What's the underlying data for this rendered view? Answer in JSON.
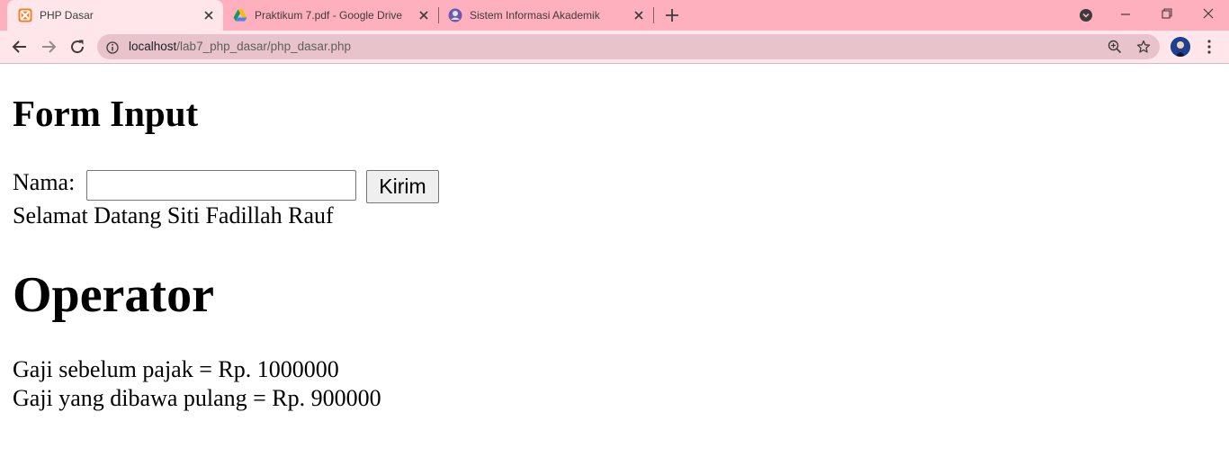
{
  "browser": {
    "tabs": [
      {
        "title": "PHP Dasar",
        "active": true,
        "icon": "xampp-icon"
      },
      {
        "title": "Praktikum 7.pdf - Google Drive",
        "active": false,
        "icon": "google-drive-icon"
      },
      {
        "title": "Sistem Informasi Akademik",
        "active": false,
        "icon": "academic-site-icon"
      }
    ],
    "address_bar": {
      "host": "localhost",
      "path": "/lab7_php_dasar/php_dasar.php"
    },
    "colors": {
      "tabstrip": "#ffb0bf",
      "active_tab": "#ffe6ea",
      "omnibox": "#e9c3cb"
    }
  },
  "page": {
    "form_heading": "Form Input",
    "name_label": "Nama:",
    "name_value": "",
    "submit_label": "Kirim",
    "greeting": "Selamat Datang Siti Fadillah Rauf",
    "operator_heading": "Operator",
    "salary_before_tax": "Gaji sebelum pajak = Rp. 1000000",
    "salary_take_home": "Gaji yang dibawa pulang = Rp. 900000"
  }
}
